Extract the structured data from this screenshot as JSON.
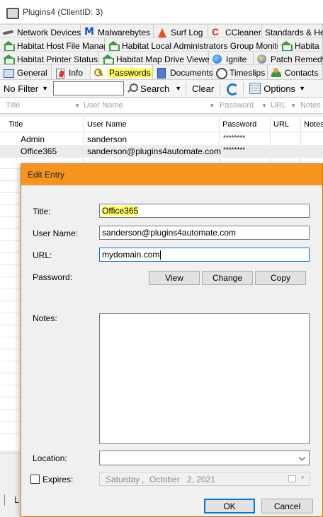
{
  "window": {
    "title": "Plugins4   (ClientID: 3)"
  },
  "tabs_row1": [
    {
      "label": "Network Devices",
      "icon": "network-cable-icon"
    },
    {
      "label": "Malwarebytes",
      "icon": "malwarebytes-icon"
    },
    {
      "label": "Surf Log",
      "icon": "surf-log-icon"
    },
    {
      "label": "CCleaner",
      "icon": "ccleaner-icon"
    },
    {
      "label": "Standards & Hea",
      "icon": ""
    }
  ],
  "tabs_row2": [
    {
      "label": "Habitat Host File Manager",
      "icon": "house-icon"
    },
    {
      "label": "Habitat Local Administrators Group Monitor",
      "icon": "house-icon"
    },
    {
      "label": "Habita",
      "icon": "house-icon"
    }
  ],
  "tabs_row3": [
    {
      "label": "Habitat Printer Status",
      "icon": "house-icon"
    },
    {
      "label": "Habitat Map Drive Viewer",
      "icon": "house-icon"
    },
    {
      "label": "Ignite",
      "icon": "globe-icon"
    },
    {
      "label": "Patch Remedy",
      "icon": "patch-icon"
    }
  ],
  "tabs_row4": [
    {
      "label": "General",
      "icon": "general-icon"
    },
    {
      "label": "Info",
      "icon": "info-icon"
    },
    {
      "label": "Passwords",
      "icon": "key-icon",
      "active": true
    },
    {
      "label": "Documents",
      "icon": "documents-icon"
    },
    {
      "label": "Timeslips",
      "icon": "clock-icon"
    },
    {
      "label": "Contacts",
      "icon": "contacts-icon"
    }
  ],
  "toolbar": {
    "filter_label": "No Filter",
    "search_value": "",
    "search_label": "Search",
    "clear_label": "Clear",
    "options_label": "Options"
  },
  "filter_row": {
    "title": "Title",
    "user_name": "User Name",
    "password": "Password",
    "url": "URL",
    "notes": "Notes"
  },
  "grid": {
    "headers": {
      "title": "Title",
      "user_name": "User Name",
      "password": "Password",
      "url": "URL",
      "notes": "Notes"
    },
    "rows": [
      {
        "title": "Admin",
        "user_name": "sanderson",
        "password": "********",
        "url": "",
        "notes": ""
      },
      {
        "title": "Office365",
        "user_name": "sanderson@plugins4automate.com",
        "password": "********",
        "url": "",
        "notes": ""
      }
    ]
  },
  "bottom": {
    "fragment": "L"
  },
  "dialog": {
    "title": "Edit Entry",
    "title_label": "Title:",
    "title_value": "Office365",
    "username_label": "User Name:",
    "username_value": "sanderson@plugins4automate.com",
    "url_label": "URL:",
    "url_value": "mydomain.com",
    "password_label": "Password:",
    "view_label": "View",
    "change_label": "Change",
    "copy_label": "Copy",
    "notes_label": "Notes:",
    "notes_value": "",
    "location_label": "Location:",
    "location_value": "",
    "expires_label": "Expires:",
    "expires_checked": false,
    "date": {
      "weekday": "Saturday",
      "sep": ",",
      "month": "October",
      "day": "2, 2021"
    },
    "ok_label": "OK",
    "cancel_label": "Cancel"
  },
  "colors": {
    "dialog_title_bg": "#f7941d",
    "highlight": "#ffff66",
    "focus_border": "#0a6cd6"
  }
}
